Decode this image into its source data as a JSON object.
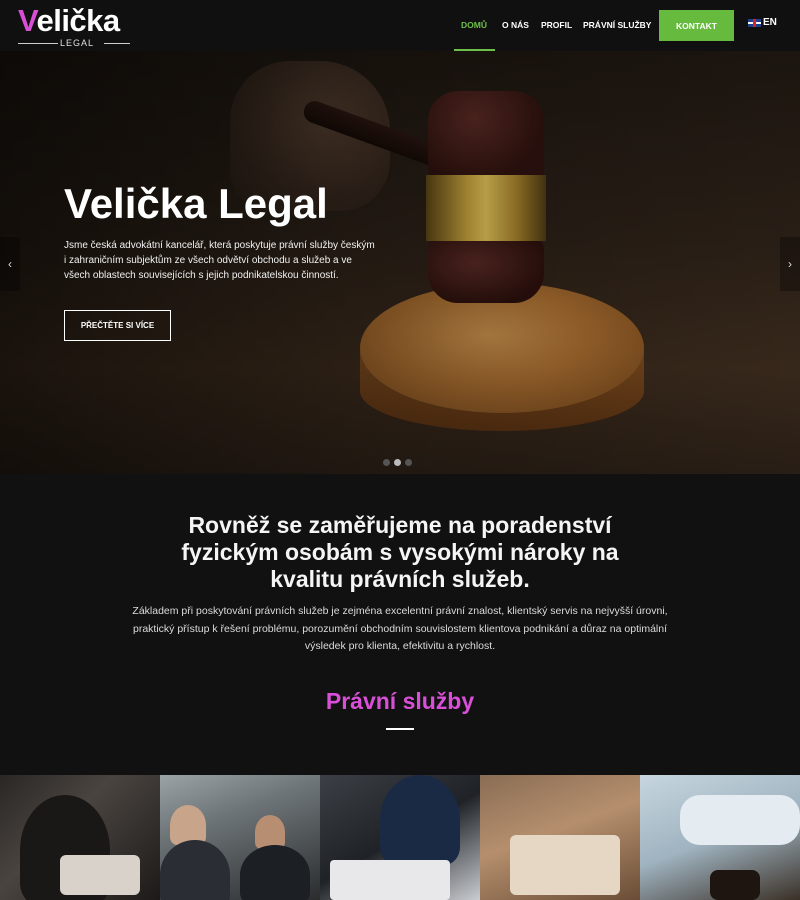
{
  "header": {
    "logo": {
      "initial": "V",
      "rest": "elička",
      "sub": "LEGAL"
    },
    "nav": [
      {
        "label": "DOMŮ",
        "active": true
      },
      {
        "label": "O NÁS",
        "active": false
      },
      {
        "label": "PROFIL",
        "active": false
      },
      {
        "label": "PRÁVNÍ SLUŽBY",
        "active": false
      }
    ],
    "contact_label": "KONTAKT",
    "lang_label": "EN"
  },
  "hero": {
    "title": "Velička Legal",
    "text": "Jsme česká advokátní kancelář, která poskytuje právní služby českým i zahraničním subjektům ze všech odvětví obchodu a služeb a ve všech oblastech souvisejících s jejich podnikatelskou činností.",
    "button_label": "PŘEČTĚTE SI VÍCE",
    "prev_arrow": "‹",
    "next_arrow": "›",
    "slides_count": 3,
    "active_slide": 2
  },
  "intro": {
    "heading": "Rovněž se zaměřujeme na poradenství fyzickým osobám s vysokými nároky na kvalitu právních služeb.",
    "text": "Základem při poskytování právních služeb je zejména excelentní právní znalost, klientský servis na nejvyšší úrovni, praktický přístup k řešení problému, porozumění obchodním souvislostem klientova podnikání a důraz na optimální výsledek pro klienta, efektivitu a rychlost.",
    "services_title": "Právní služby"
  },
  "colors": {
    "accent_green": "#66bb3f",
    "accent_pink": "#d94fd8",
    "background": "#111111"
  }
}
